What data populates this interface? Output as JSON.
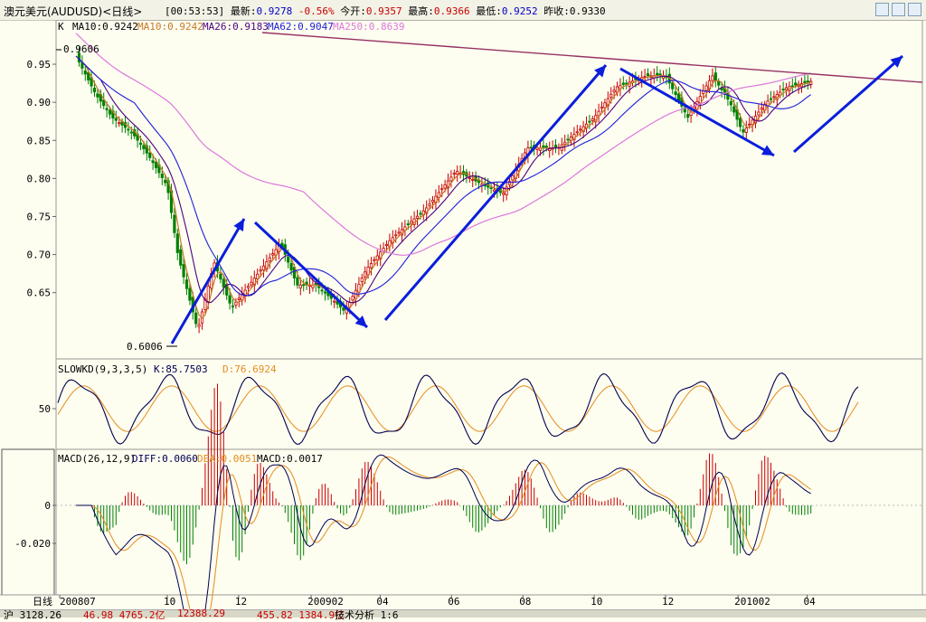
{
  "title_bar": {
    "name": "澳元美元(AUDUSD)<日线>",
    "time": "[00:53:53]",
    "latest_label": "最新:",
    "latest": "0.9278",
    "change": "-0.56%",
    "open_label": "今开:",
    "open": "0.9357",
    "high_label": "最高:",
    "high": "0.9366",
    "low_label": "最低:",
    "low": "0.9252",
    "prev_label": "昨收:",
    "prev": "0.9330"
  },
  "main_panel": {
    "indicator_line": {
      "k": "K",
      "ma10a": "MA10:0.9242",
      "ma10b": "MA10:0.9242",
      "ma26": "MA26:0.9183",
      "ma62": "MA62:0.9047",
      "ma250": "MA250:0.8639"
    },
    "high_annotation": "0.9606",
    "low_annotation": "0.6006"
  },
  "kd_panel": {
    "label": "SLOWKD(9,3,3,5)",
    "k": "K:85.7503",
    "d": "D:76.6924",
    "tick": "50"
  },
  "macd_panel": {
    "label": "MACD(26,12,9)",
    "diff": "DIFF:0.0060",
    "dea": "DEA:0.0051",
    "macd": "MACD:0.0017",
    "ticks": [
      "0",
      "-0.020"
    ]
  },
  "x_axis": {
    "period_label": "日线",
    "labels": [
      "200807",
      "10",
      "12",
      "200902",
      "04",
      "06",
      "08",
      "10",
      "12",
      "201002",
      "04"
    ]
  },
  "status_bar": {
    "items": [
      "沪 3128.26",
      "46.98 4765.2亿",
      "12388.29",
      "455.82 1384.9亿",
      "技术分析 1:6"
    ]
  },
  "colors": {
    "up": "#c80000",
    "down": "#008000",
    "ma10": "#c87828",
    "ma26": "#4b0082",
    "ma62": "#1e1edc",
    "ma250": "#dc78dc",
    "arrow": "#0a1edc",
    "trend": "#963264",
    "kd_k": "#000050",
    "kd_d": "#e68c1e"
  },
  "chart_data": {
    "type": "candlestick",
    "instrument": "AUDUSD",
    "period": "daily",
    "y_ticks": [
      0.95,
      0.9,
      0.85,
      0.8,
      0.75,
      0.7,
      0.65
    ],
    "ylim": [
      0.595,
      0.975
    ],
    "x_range": [
      "2008-07",
      "2010-04"
    ],
    "price_path": [
      [
        "2008-07-15",
        0.9606
      ],
      [
        "2008-08-01",
        0.91
      ],
      [
        "2008-08-15",
        0.88
      ],
      [
        "2008-09-01",
        0.86
      ],
      [
        "2008-09-15",
        0.83
      ],
      [
        "2008-10-01",
        0.79
      ],
      [
        "2008-10-10",
        0.7
      ],
      [
        "2008-10-27",
        0.6006
      ],
      [
        "2008-11-10",
        0.69
      ],
      [
        "2008-11-25",
        0.63
      ],
      [
        "2008-12-15",
        0.67
      ],
      [
        "2009-01-06",
        0.715
      ],
      [
        "2009-01-20",
        0.66
      ],
      [
        "2009-02-05",
        0.66
      ],
      [
        "2009-02-20",
        0.64
      ],
      [
        "2009-03-02",
        0.625
      ],
      [
        "2009-03-20",
        0.68
      ],
      [
        "2009-04-10",
        0.72
      ],
      [
        "2009-05-10",
        0.76
      ],
      [
        "2009-06-05",
        0.81
      ],
      [
        "2009-06-30",
        0.79
      ],
      [
        "2009-07-15",
        0.78
      ],
      [
        "2009-08-05",
        0.84
      ],
      [
        "2009-08-31",
        0.84
      ],
      [
        "2009-10-01",
        0.88
      ],
      [
        "2009-10-20",
        0.92
      ],
      [
        "2009-11-15",
        0.935
      ],
      [
        "2009-12-01",
        0.935
      ],
      [
        "2009-12-20",
        0.88
      ],
      [
        "2010-01-10",
        0.935
      ],
      [
        "2010-01-25",
        0.9
      ],
      [
        "2010-02-05",
        0.86
      ],
      [
        "2010-02-25",
        0.9
      ],
      [
        "2010-03-15",
        0.92
      ],
      [
        "2010-04-05",
        0.9278
      ]
    ],
    "moving_averages": {
      "ma10": 0.9242,
      "ma26": 0.9183,
      "ma62": 0.9047,
      "ma250": 0.8639
    },
    "slowkd": {
      "k": 85.7503,
      "d": 76.6924,
      "tick": 50
    },
    "macd": {
      "diff": 0.006,
      "dea": 0.0051,
      "macd": 0.0017,
      "ticks": [
        0,
        -0.02
      ]
    }
  }
}
